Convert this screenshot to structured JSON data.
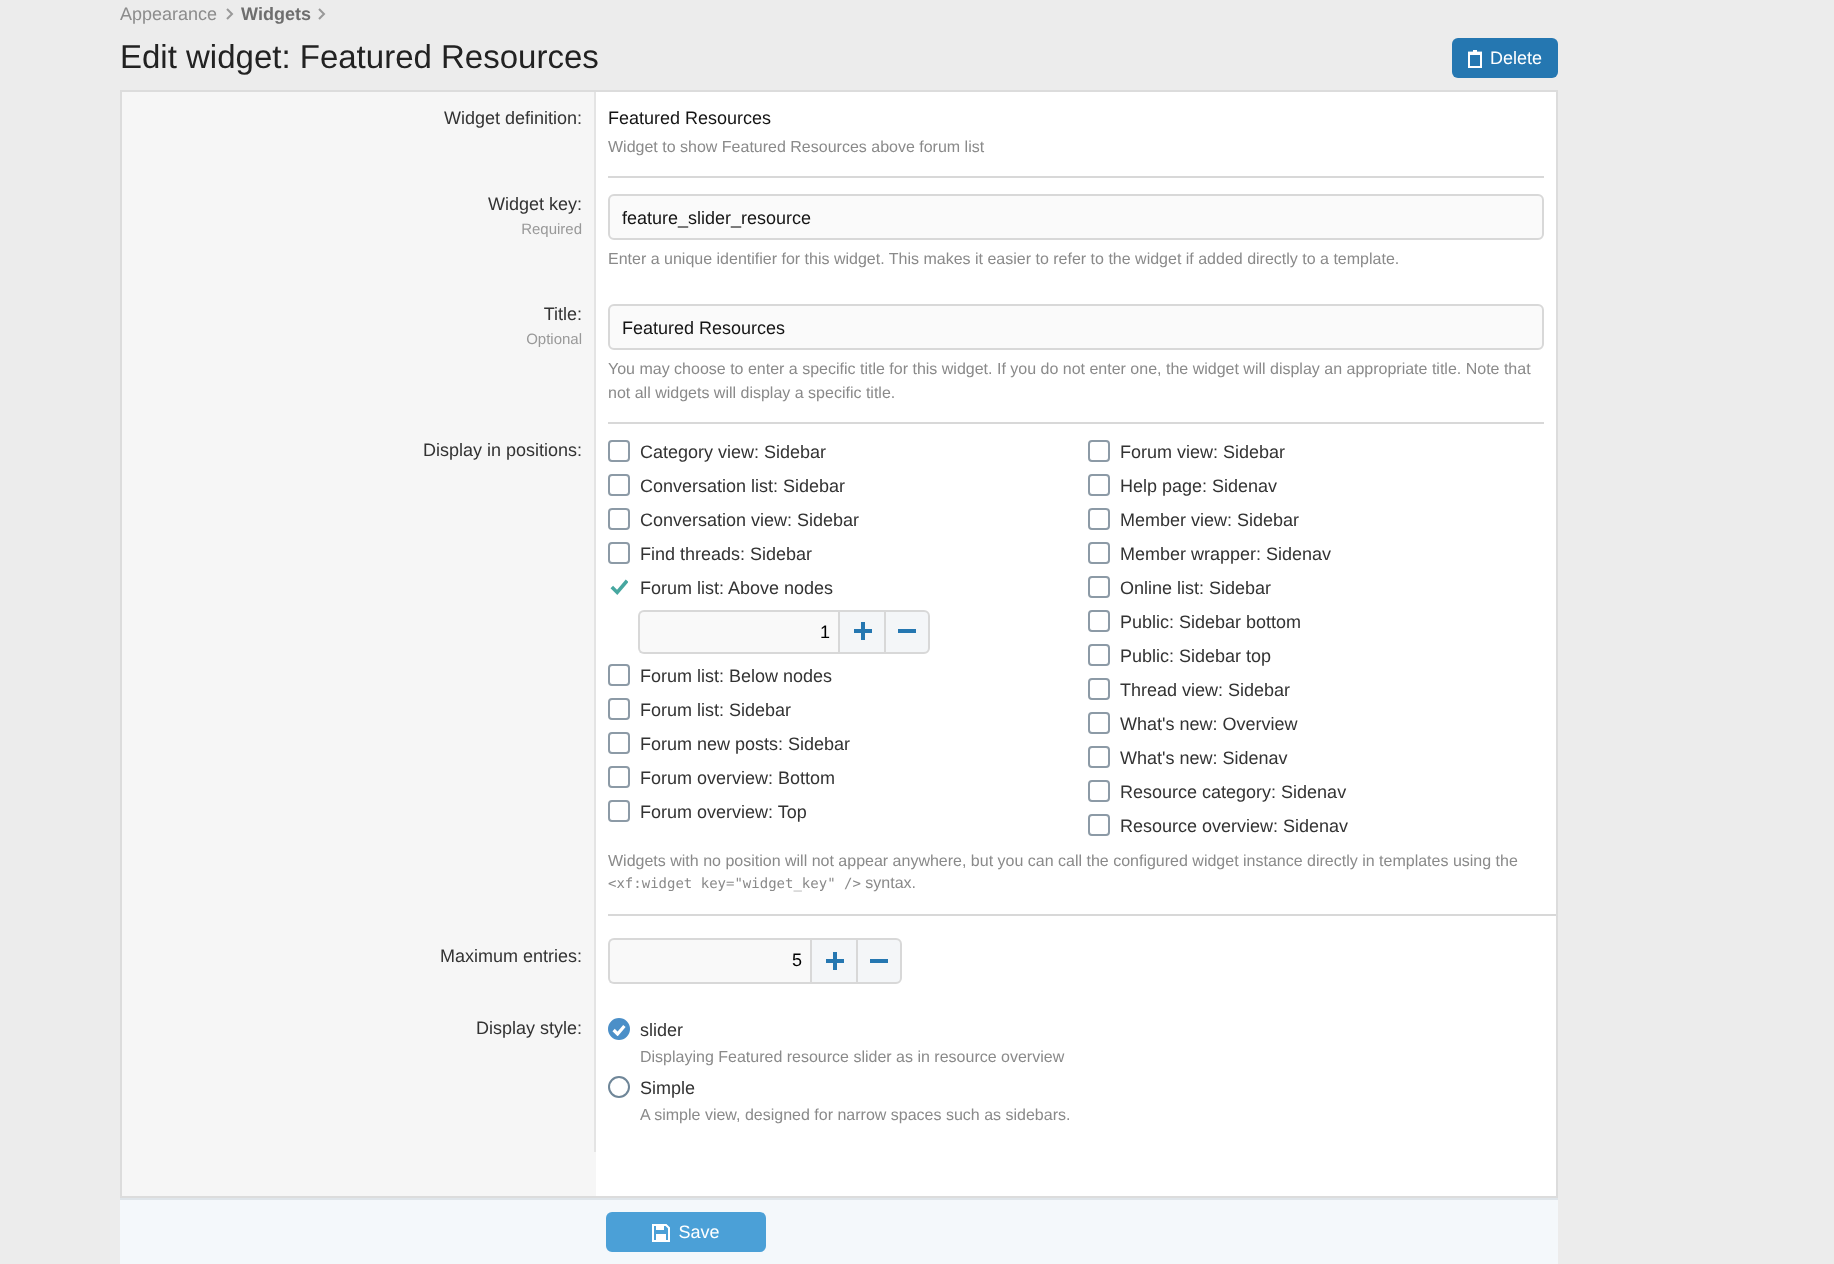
{
  "breadcrumbs": [
    "Appearance",
    "Widgets"
  ],
  "title": "Edit widget: Featured Resources",
  "delete_button": "Delete",
  "definition": {
    "label": "Widget definition:",
    "value": "Featured Resources",
    "description": "Widget to show Featured Resources above forum list"
  },
  "widget_key": {
    "label": "Widget key:",
    "note": "Required",
    "value": "feature_slider_resource",
    "hint": "Enter a unique identifier for this widget. This makes it easier to refer to the widget if added directly to a template."
  },
  "widget_title": {
    "label": "Title:",
    "note": "Optional",
    "value": "Featured Resources",
    "hint": "You may choose to enter a specific title for this widget. If you do not enter one, the widget will display an appropriate title. Note that not all widgets will display a specific title."
  },
  "positions": {
    "label": "Display in positions:",
    "columns": [
      [
        {
          "label": "Category view: Sidebar",
          "checked": false
        },
        {
          "label": "Conversation list: Sidebar",
          "checked": false
        },
        {
          "label": "Conversation view: Sidebar",
          "checked": false
        },
        {
          "label": "Find threads: Sidebar",
          "checked": false
        },
        {
          "label": "Forum list: Above nodes",
          "checked": true,
          "order": "1"
        },
        {
          "label": "Forum list: Below nodes",
          "checked": false
        },
        {
          "label": "Forum list: Sidebar",
          "checked": false
        },
        {
          "label": "Forum new posts: Sidebar",
          "checked": false
        },
        {
          "label": "Forum overview: Bottom",
          "checked": false
        },
        {
          "label": "Forum overview: Top",
          "checked": false
        }
      ],
      [
        {
          "label": "Forum view: Sidebar",
          "checked": false
        },
        {
          "label": "Help page: Sidenav",
          "checked": false
        },
        {
          "label": "Member view: Sidebar",
          "checked": false
        },
        {
          "label": "Member wrapper: Sidenav",
          "checked": false
        },
        {
          "label": "Online list: Sidebar",
          "checked": false
        },
        {
          "label": "Public: Sidebar bottom",
          "checked": false
        },
        {
          "label": "Public: Sidebar top",
          "checked": false
        },
        {
          "label": "Thread view: Sidebar",
          "checked": false
        },
        {
          "label": "What's new: Overview",
          "checked": false
        },
        {
          "label": "What's new: Sidenav",
          "checked": false
        },
        {
          "label": "Resource category: Sidenav",
          "checked": false
        },
        {
          "label": "Resource overview: Sidenav",
          "checked": false
        }
      ]
    ],
    "hint_before": "Widgets with no position will not appear anywhere, but you can call the configured widget instance directly in templates using the",
    "hint_code": "<xf:widget key=\"widget_key\" />",
    "hint_after": "syntax."
  },
  "max_entries": {
    "label": "Maximum entries:",
    "value": "5"
  },
  "display_style": {
    "label": "Display style:",
    "options": [
      {
        "label": "slider",
        "description": "Displaying Featured resource slider as in resource overview",
        "selected": true
      },
      {
        "label": "Simple",
        "description": "A simple view, designed for narrow spaces such as sidebars.",
        "selected": false
      }
    ]
  },
  "save_button": "Save"
}
